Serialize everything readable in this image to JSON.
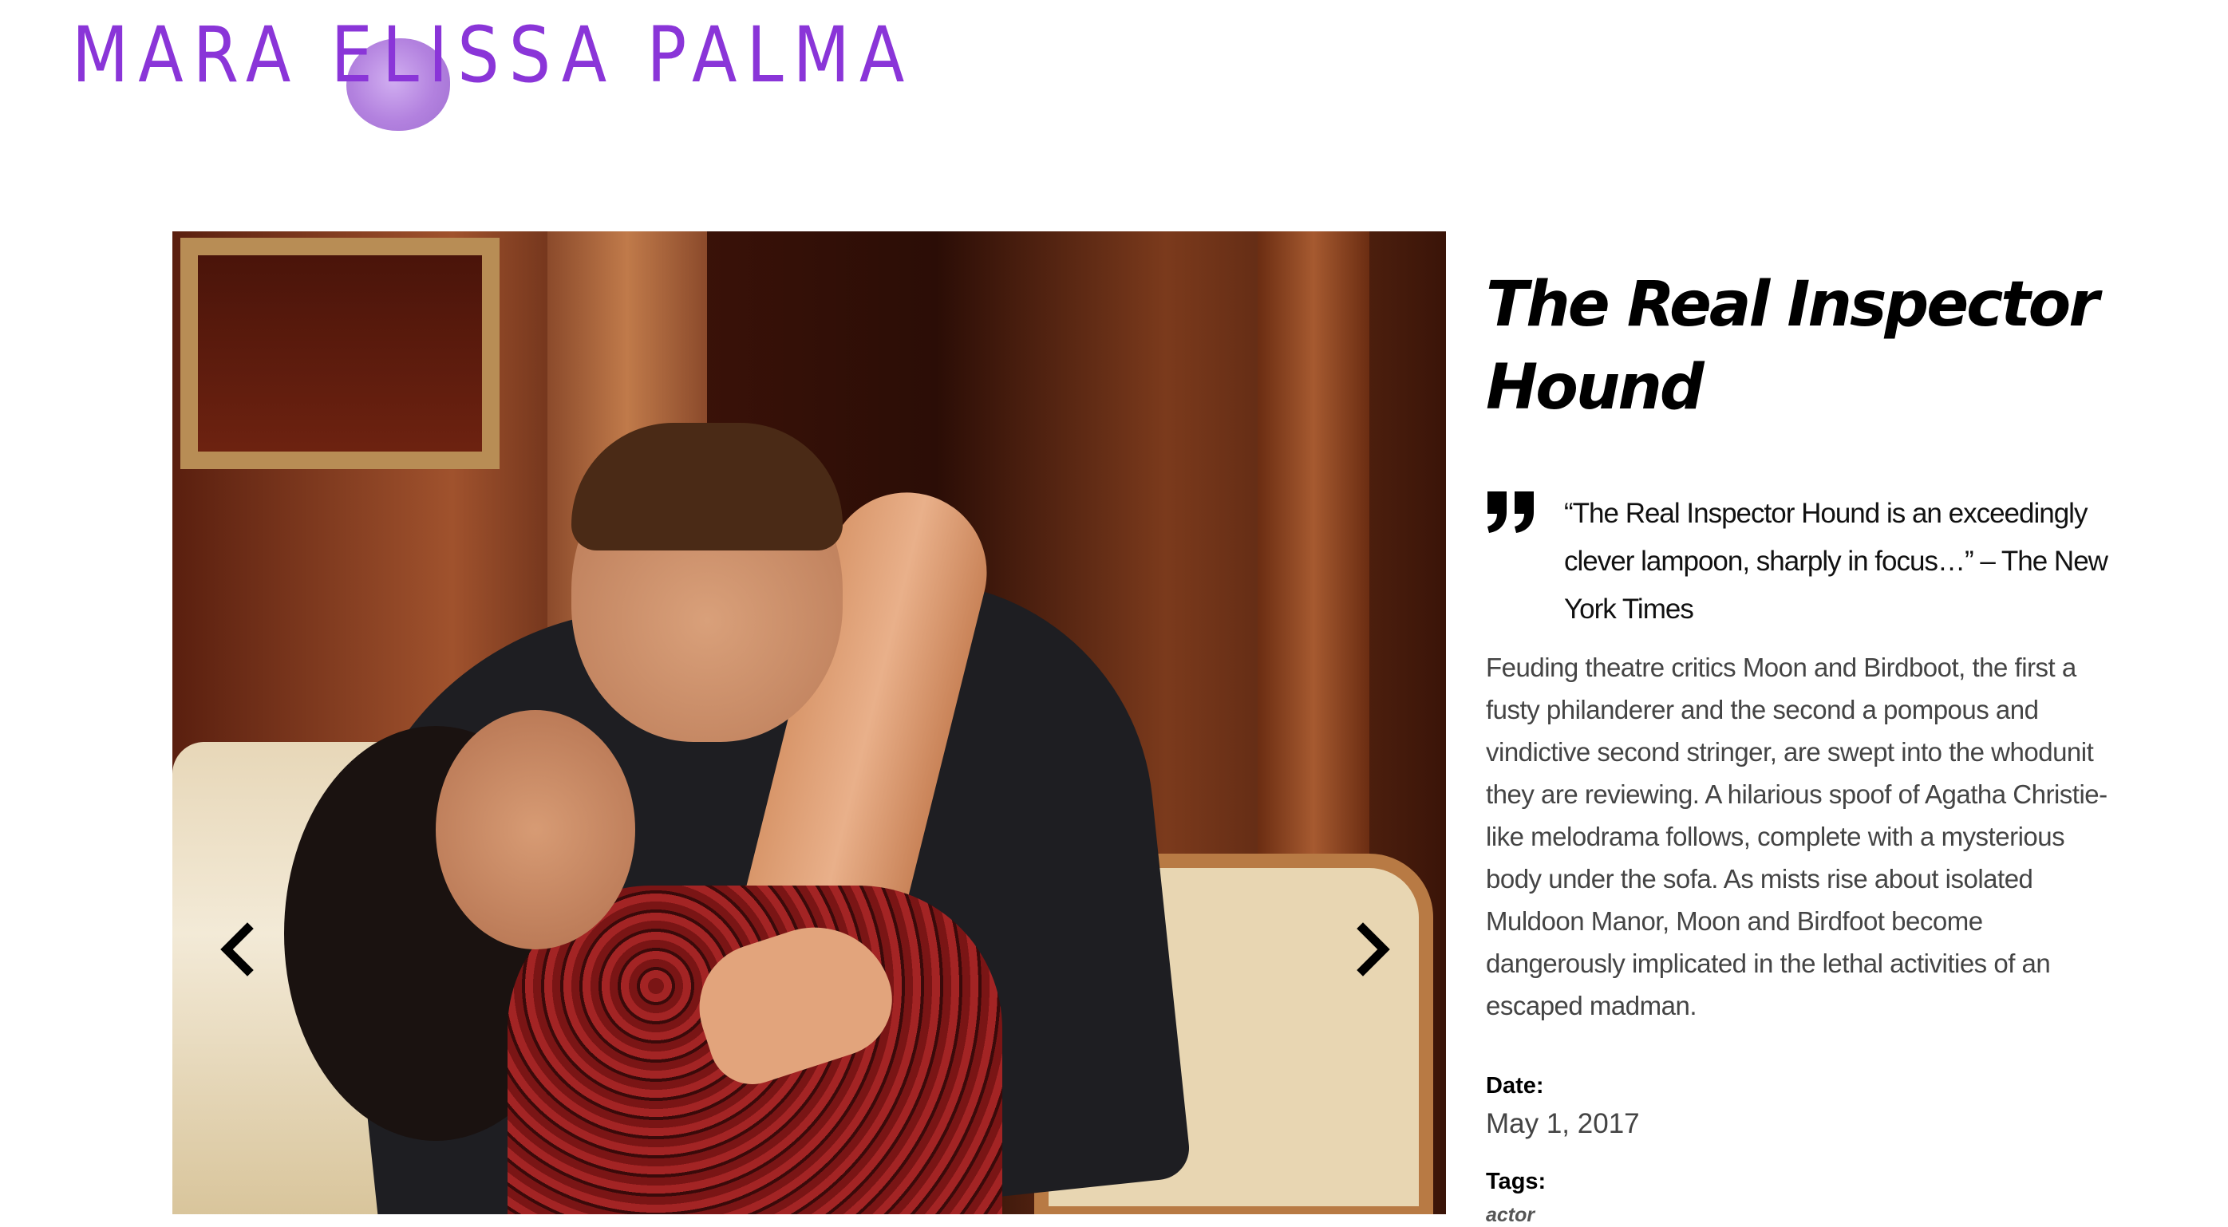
{
  "site": {
    "logo_text": "MARA ELISSA PALMA",
    "logo_color": "#8a35d8"
  },
  "gallery": {
    "image_alt": "Two performers embracing in a kiss on stage in a period drawing-room set",
    "prev_icon": "chevron-left-icon",
    "next_icon": "chevron-right-icon",
    "prev_glyph": "‹",
    "next_glyph": "›"
  },
  "project": {
    "title": "The Real Inspector Hound",
    "quote": "“The Real Inspector Hound is an exceedingly clever lampoon, sharply in focus…” – The New York Times",
    "quote_icon": "quote-icon",
    "description": "Feuding theatre critics Moon and Birdboot, the first a fusty philanderer and the second a pompous and vindictive second stringer, are swept into the whodunit they are reviewing. A hilarious spoof of Agatha Christie-like melodrama follows, complete with a mysterious body under the sofa. As mists rise about isolated Muldoon Manor, Moon and Birdfoot become dangerously implicated in the lethal activities of an escaped madman.",
    "date_label": "Date:",
    "date_value": "May 1, 2017",
    "tags_label": "Tags:",
    "tags": [
      "actor"
    ]
  }
}
